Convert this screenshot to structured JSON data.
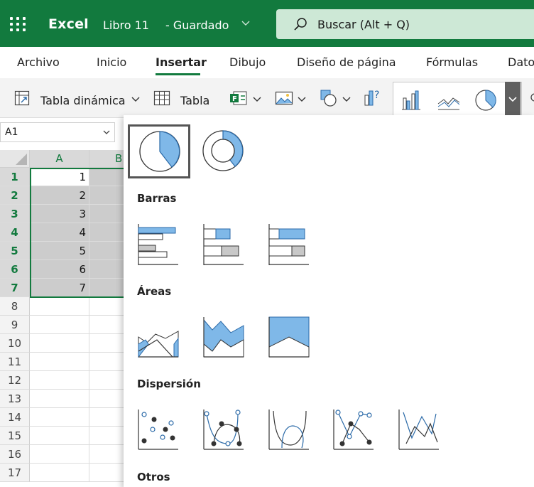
{
  "app": {
    "name": "Excel",
    "doc_name": "Libro 11",
    "status": "-  Guardado"
  },
  "search": {
    "text": "Buscar (Alt + Q)"
  },
  "tabs": [
    {
      "label": "Archivo"
    },
    {
      "label": "Inicio"
    },
    {
      "label": "Insertar",
      "active": true
    },
    {
      "label": "Dibujo"
    },
    {
      "label": "Diseño de página"
    },
    {
      "label": "Fórmulas"
    },
    {
      "label": "Datos"
    }
  ],
  "ribbon": {
    "pivot_label": "Tabla dinámica",
    "table_label": "Tabla"
  },
  "namebox": {
    "value": "A1"
  },
  "grid": {
    "columns": [
      "A",
      "B"
    ],
    "rows": [
      "1",
      "2",
      "3",
      "4",
      "5",
      "6",
      "7",
      "8",
      "9",
      "10",
      "11",
      "12",
      "13",
      "14",
      "15",
      "16",
      "17"
    ],
    "values_a": [
      "1",
      "2",
      "3",
      "4",
      "5",
      "6",
      "7"
    ]
  },
  "panel": {
    "sections": {
      "bars": "Barras",
      "areas": "Áreas",
      "scatter": "Dispersión",
      "other": "Otros"
    }
  },
  "colors": {
    "accent": "#127a3e",
    "chart_blue": "#7fb8e8",
    "chart_stroke": "#2b6aa8"
  }
}
